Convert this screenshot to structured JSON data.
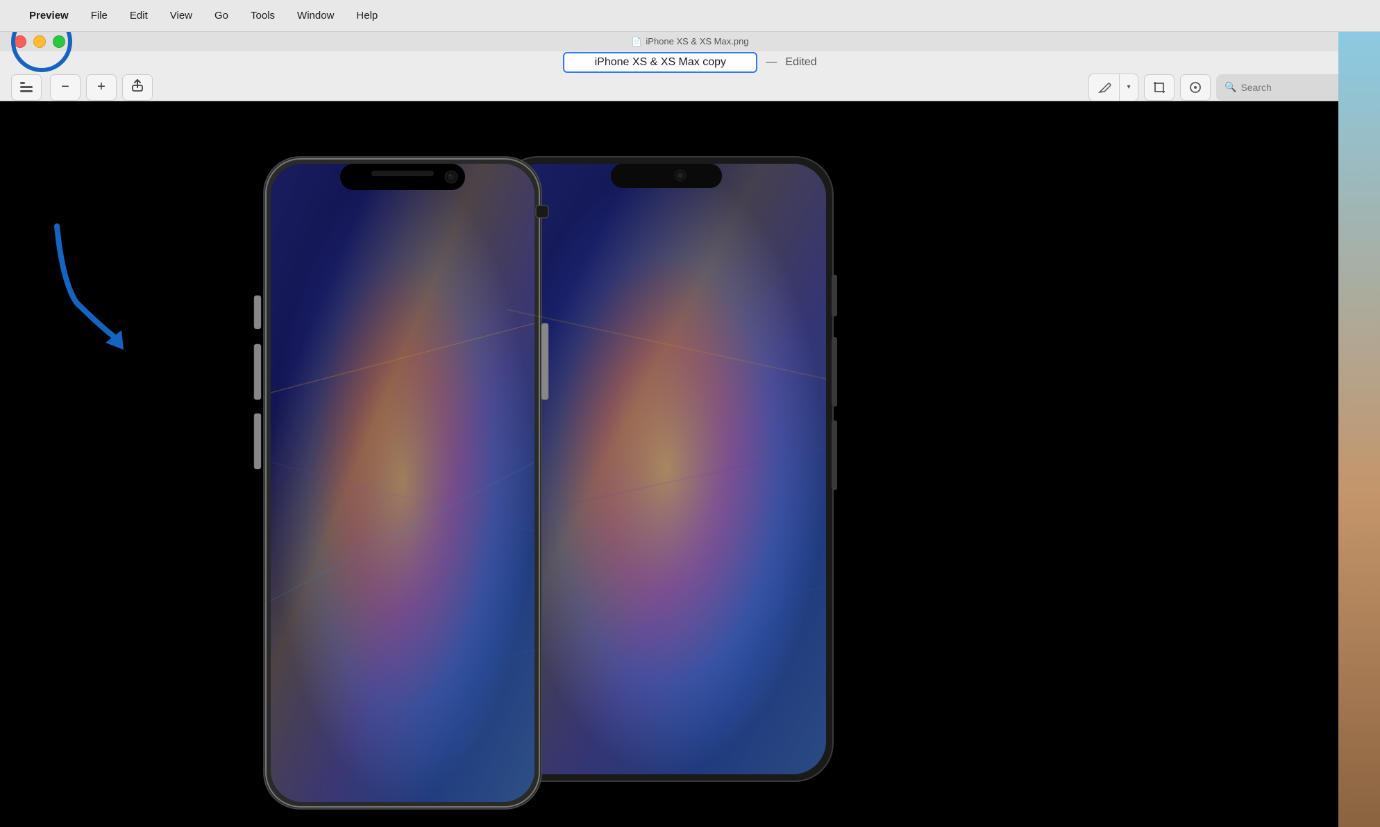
{
  "menubar": {
    "apple_symbol": "",
    "items": [
      {
        "label": "Preview",
        "active": true
      },
      {
        "label": "File"
      },
      {
        "label": "Edit"
      },
      {
        "label": "View"
      },
      {
        "label": "Go"
      },
      {
        "label": "Tools"
      },
      {
        "label": "Window"
      },
      {
        "label": "Help"
      }
    ]
  },
  "tab": {
    "title": "iPhone XS & XS Max.png",
    "icon": "📄"
  },
  "titlebar": {
    "doc_title": "iPhone XS & XS Max copy",
    "dash": "—",
    "edited_label": "Edited"
  },
  "toolbar": {
    "zoom_out_label": "−",
    "zoom_in_label": "+",
    "share_label": "⬆",
    "markup_pen_label": "✏",
    "markup_dropdown_label": "▾",
    "markup_crop_label": "⬛",
    "markup_annotate_label": "◎",
    "search_placeholder": "Search",
    "search_icon": "🔍"
  },
  "annotations": {
    "circle_color": "#1565C0",
    "arrow_color": "#1565C0"
  },
  "window_controls": {
    "close_color": "#ff5f57",
    "minimize_color": "#febc2e",
    "maximize_color": "#28c840"
  },
  "image": {
    "description": "iPhone XS and XS Max promotional photo on black background",
    "background_color": "#000000"
  },
  "desktop_edge": {
    "visible": true
  }
}
